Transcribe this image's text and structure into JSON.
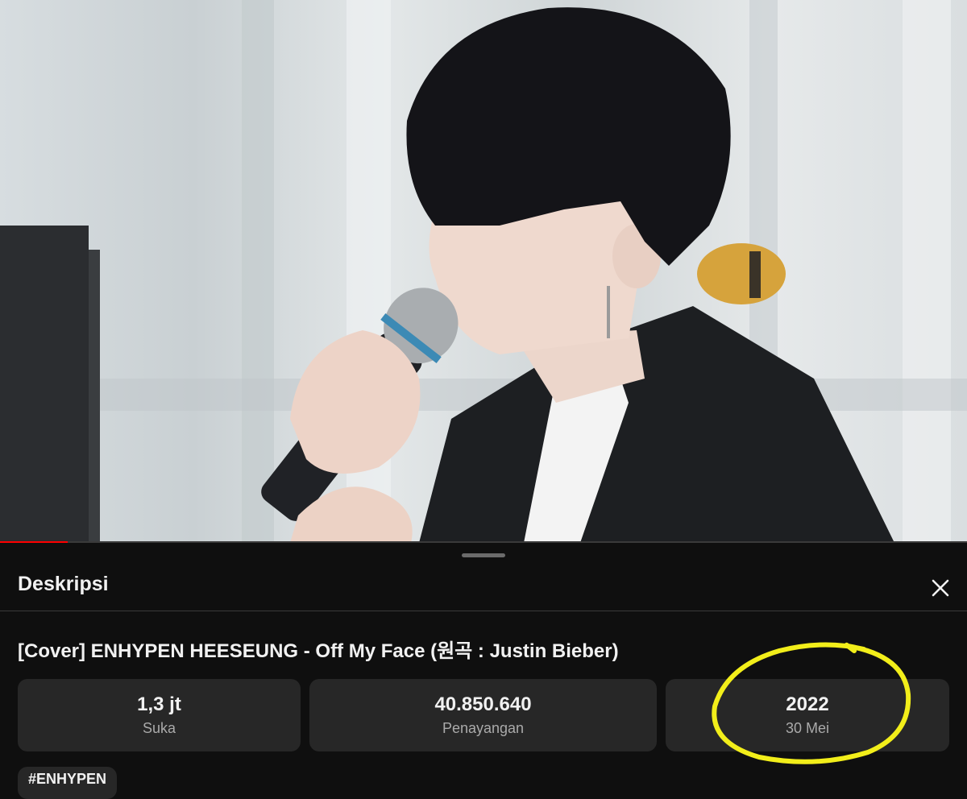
{
  "video": {
    "progress_fraction": 0.07
  },
  "description_panel": {
    "title": "Deskripsi",
    "close_icon": "close-icon",
    "video_title": "[Cover] ENHYPEN HEESEUNG - Off My Face (원곡 : Justin Bieber)",
    "stats": [
      {
        "value": "1,3 jt",
        "label": "Suka"
      },
      {
        "value": "40.850.640",
        "label": "Penayangan"
      },
      {
        "value": "2022",
        "label": "30 Mei"
      }
    ],
    "hashtag": "#ENHYPEN",
    "annotation_color": "#f2ee1a"
  }
}
